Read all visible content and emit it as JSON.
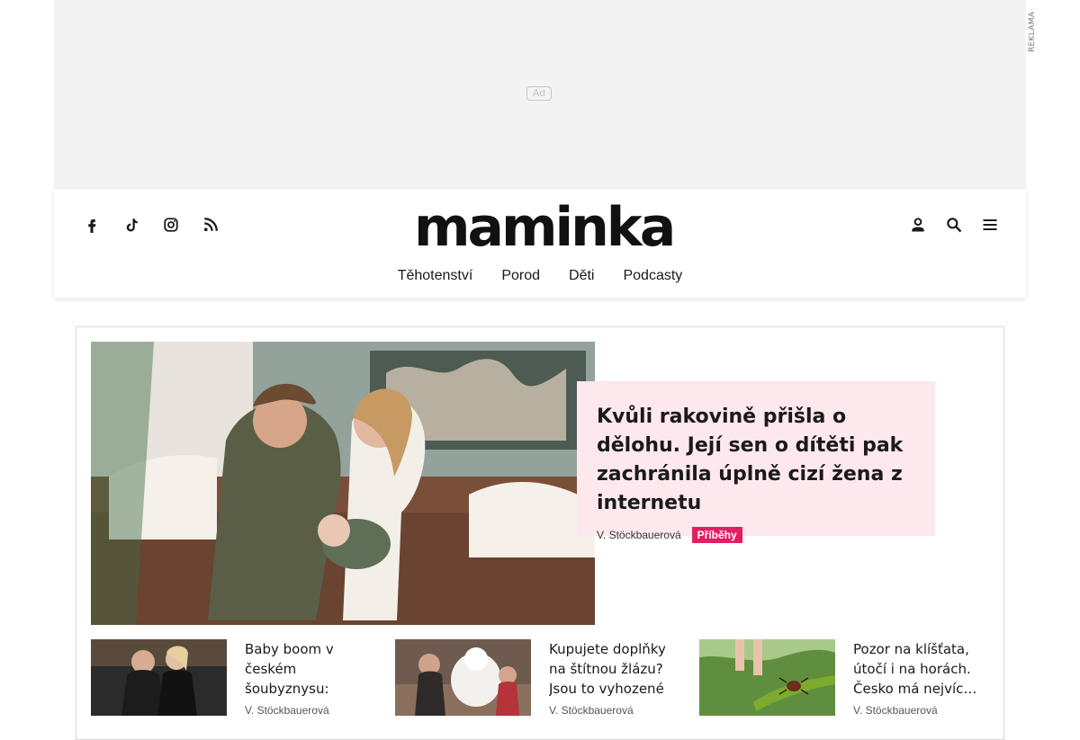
{
  "ad": {
    "badge_text": "Ad",
    "side_label": "REKLAMA"
  },
  "header": {
    "logo": "maminka",
    "social_icons": [
      "facebook-icon",
      "tiktok-icon",
      "instagram-icon",
      "rss-icon"
    ],
    "tools": [
      "account-icon",
      "search-icon",
      "menu-icon"
    ],
    "nav": [
      "Těhotenství",
      "Porod",
      "Děti",
      "Podcasty"
    ]
  },
  "hero": {
    "title": "Kvůli rakovině přišla o dělohu. Její sen o dítěti pak zachránila úplně cizí žena z internetu",
    "author": "V. Stöckbauerová",
    "tag": "Příběhy",
    "colors": {
      "card": "#fce8ed",
      "tag": "#e31e63"
    }
  },
  "teasers": [
    {
      "title": "Baby boom v českém šoubyznysu: Zpěvák Mirai…",
      "author": "V. Stöckbauerová"
    },
    {
      "title": "Kupujete doplňky na štítnou žlázu? Jsou to vyhozené peníz…",
      "author": "V. Stöckbauerová"
    },
    {
      "title": "Pozor na klíšťata, útočí i na horách. Česko má nejvíc…",
      "author": "V. Stöckbauerová"
    }
  ]
}
